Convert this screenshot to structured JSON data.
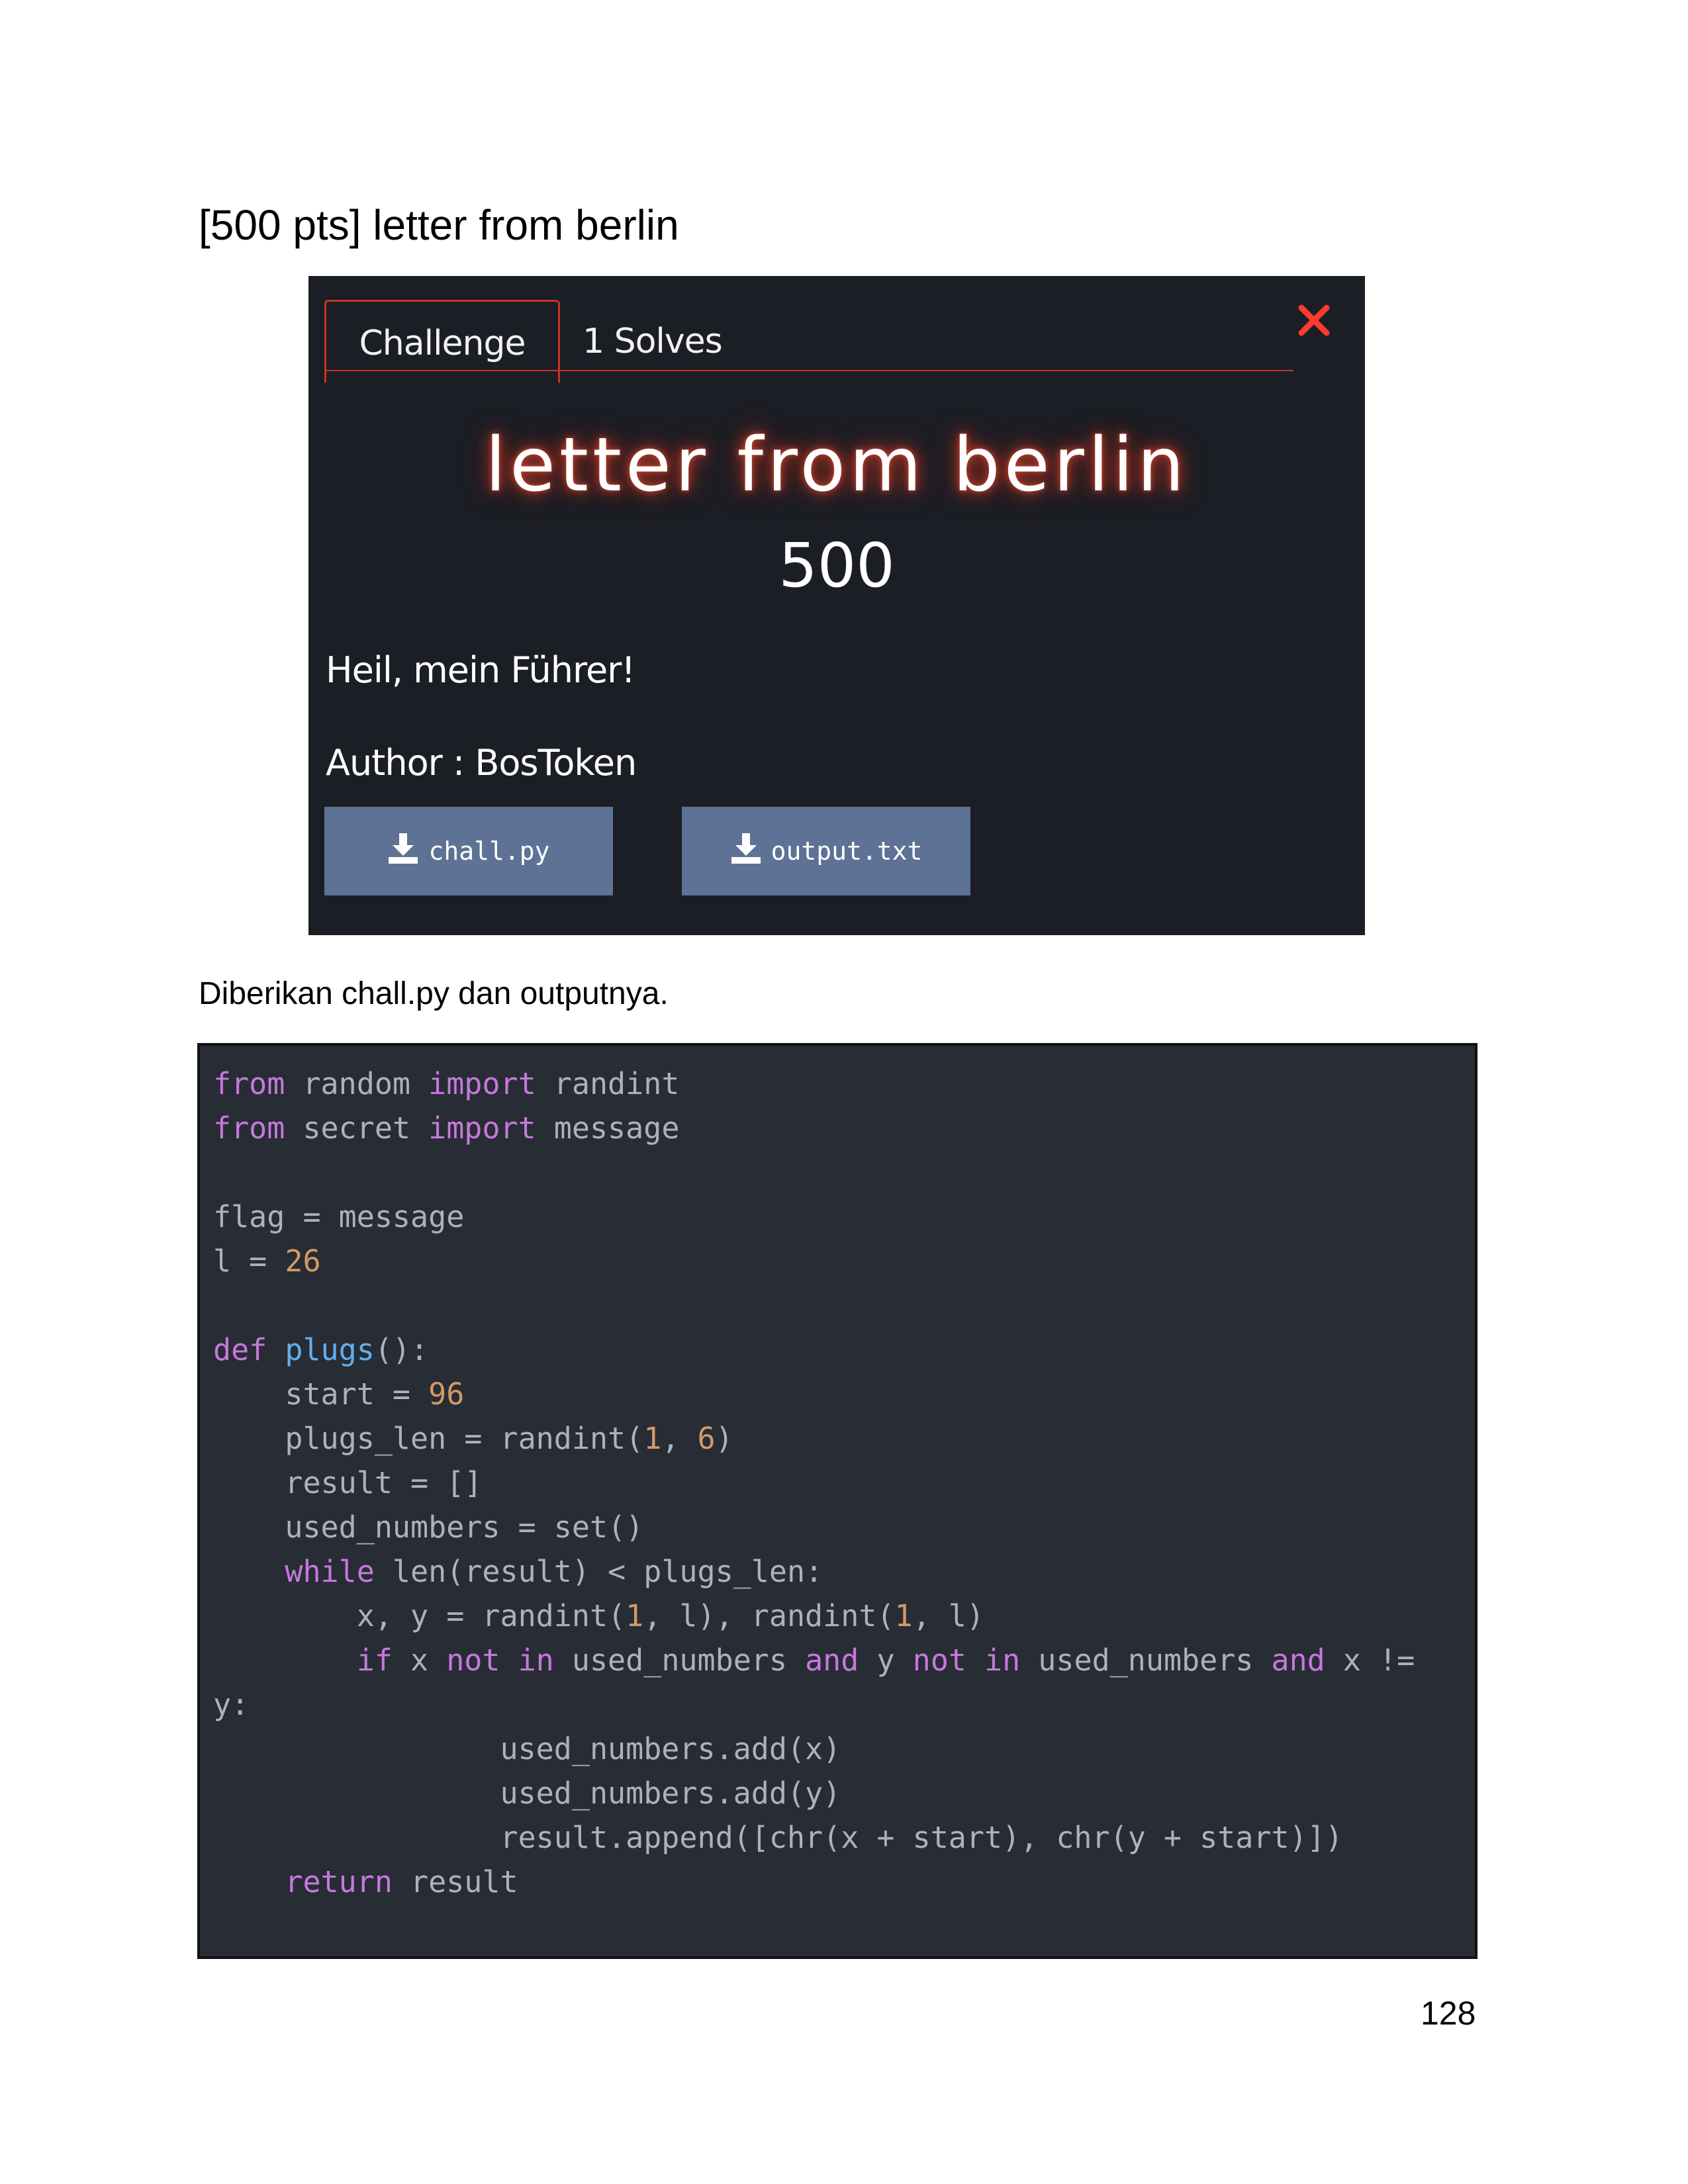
{
  "heading": "[500 pts] letter from berlin",
  "modal": {
    "tab_challenge": "Challenge",
    "tab_solves": "1 Solves",
    "title": "letter from berlin",
    "points": "500",
    "description": "Heil, mein Führer!",
    "author": "Author : BosToken",
    "files": [
      "chall.py",
      "output.txt"
    ],
    "icons": {
      "close": "close-icon",
      "download": "download-icon"
    },
    "colors": {
      "background": "#1c1e25",
      "accent": "#c63526",
      "button": "#5d7294"
    }
  },
  "paragraph": "Diberikan chall.py dan outputnya.",
  "code": {
    "l1": {
      "kw1": "from",
      "t1": " random ",
      "kw2": "import",
      "t2": " randint"
    },
    "l2": {
      "kw1": "from",
      "t1": " secret ",
      "kw2": "import",
      "t2": " message"
    },
    "l4": "flag = message",
    "l5": {
      "t1": "l = ",
      "n1": "26"
    },
    "l7": {
      "kw": "def",
      "t1": " ",
      "fn": "plugs",
      "t2": "():"
    },
    "l8": {
      "t1": "    start = ",
      "n1": "96"
    },
    "l9": {
      "t1": "    plugs_len = randint(",
      "n1": "1",
      "t2": ", ",
      "n2": "6",
      "t3": ")"
    },
    "l10": "    result = []",
    "l11": "    used_numbers = set()",
    "l12": {
      "t0": "    ",
      "kw": "while",
      "t1": " len(result) < plugs_len:"
    },
    "l13": {
      "t1": "        x, y = randint(",
      "n1": "1",
      "t2": ", l), randint(",
      "n2": "1",
      "t3": ", l)"
    },
    "l14": {
      "t0": "        ",
      "kw1": "if",
      "t1": " x ",
      "kw2": "not",
      "t2": " ",
      "kw3": "in",
      "t3": " used_numbers ",
      "kw4": "and",
      "t4": " y ",
      "kw5": "not",
      "t5": " ",
      "kw6": "in",
      "t6": " used_numbers ",
      "kw7": "and",
      "t7": " x !="
    },
    "l15": "y:",
    "l16": "                used_numbers.add(x)",
    "l17": "                used_numbers.add(y)",
    "l18": "                result.append([chr(x + start), chr(y + start)])",
    "l19": {
      "t0": "    ",
      "kw": "return",
      "t1": " result"
    },
    "colors": {
      "background": "#282c34",
      "keyword": "#c678dd",
      "number": "#d19a66",
      "function": "#61afef",
      "text": "#abb2bf"
    }
  },
  "page_number": "128"
}
